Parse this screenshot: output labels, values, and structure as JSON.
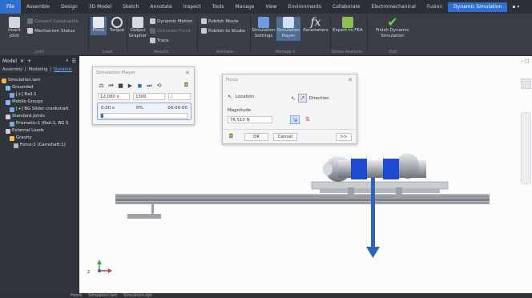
{
  "menu": {
    "tabs": [
      "File",
      "Assemble",
      "Design",
      "3D Model",
      "Sketch",
      "Annotate",
      "Inspect",
      "Tools",
      "Manage",
      "View",
      "Environments",
      "Collaborate",
      "Electromechanical",
      "Fusion",
      "Dynamic Simulation"
    ],
    "extra": "▪ ▾"
  },
  "ribbon": {
    "insert_joint": "Insert Joint",
    "convert_constraints": "Convert Constraints",
    "mechanism_status": "Mechanism Status",
    "force": "Force",
    "torque": "Torque",
    "output_grapher": "Output Grapher",
    "dynamic_motion": "Dynamic Motion",
    "unknown_force": "Unknown Force",
    "trace": "Trace",
    "publish_movie": "Publish Movie",
    "publish_to_studio": "Publish to Studio",
    "simulation_settings": "Simulation Settings",
    "simulation_player": "Simulation Player",
    "parameters": "Parameters",
    "export_to_fea": "Export to FEA",
    "finish": "Finish Dynamic Simulation",
    "groups": {
      "joint": "Joint",
      "load": "Load",
      "results": "Results",
      "animate": "Animate",
      "manage": "Manage ▾",
      "stress_analysis": "Stress Analysis",
      "exit": "Exit"
    }
  },
  "browser": {
    "title": "Model",
    "tabs": [
      "Assembly",
      "Modeling",
      "Dynamic"
    ],
    "active_tab": "Dynamic",
    "nodes": [
      {
        "label": "Simulation.iam",
        "indent": 0,
        "icon": "#e6b24a"
      },
      {
        "label": "Grounded",
        "indent": 1,
        "icon": "#8db8f0"
      },
      {
        "label": "[+] Rail:1",
        "indent": 2,
        "icon": "#7aa7e0"
      },
      {
        "label": "Mobile Groups",
        "indent": 1,
        "icon": "#8db8f0"
      },
      {
        "label": "[+] BG Slider crankshaft",
        "indent": 2,
        "icon": "#7aa7e0"
      },
      {
        "label": "Standard Joints",
        "indent": 1,
        "icon": "#cfcfcf"
      },
      {
        "label": "Prismatic:1 (Rail:1, BG S",
        "indent": 2,
        "icon": "#7aa7e0"
      },
      {
        "label": "External Loads",
        "indent": 1,
        "icon": "#cfcfcf"
      },
      {
        "label": "Gravity",
        "indent": 2,
        "icon": "#f2c04a"
      },
      {
        "label": "Force:1 (Camshaft:1)",
        "indent": 3,
        "icon": "#b0b8c4"
      }
    ]
  },
  "sim_player": {
    "title": "Simulation Player",
    "final_time": "12,000 s",
    "images": "1300",
    "filter": "1",
    "cur_time": "0,00 s",
    "percent": "0%",
    "clock": "00:00:00",
    "progress": 0
  },
  "force_dlg": {
    "title": "Force",
    "location": "Location",
    "direction": "Direction",
    "magnitude_label": "Magnitude",
    "magnitude_value": "76,510 N",
    "ok": "OK",
    "cancel": "Cancel",
    "more": ">>"
  },
  "doc_tabs": [
    "Home",
    "Simulation.iam",
    "Simulation.dyn"
  ],
  "colors": {
    "accent": "#2f6fd0",
    "force_arrow": "#2f64b5",
    "part_blue": "#1f4bd1"
  }
}
